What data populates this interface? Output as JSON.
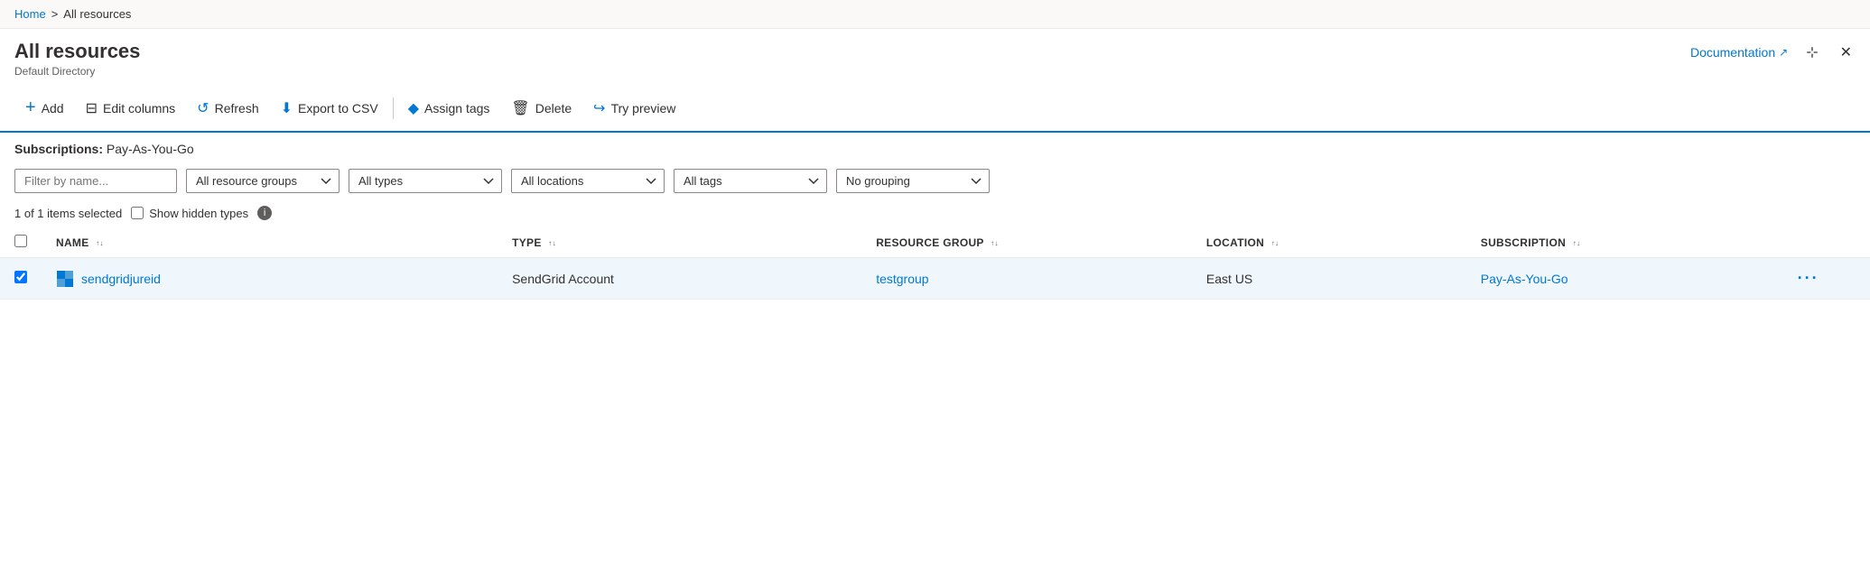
{
  "breadcrumb": {
    "home": "Home",
    "separator": ">",
    "current": "All resources"
  },
  "header": {
    "title": "All resources",
    "subtitle": "Default Directory",
    "documentation_label": "Documentation",
    "pin_title": "Pin",
    "close_title": "Close"
  },
  "toolbar": {
    "add": "Add",
    "edit_columns": "Edit columns",
    "refresh": "Refresh",
    "export_csv": "Export to CSV",
    "assign_tags": "Assign tags",
    "delete": "Delete",
    "try_preview": "Try preview"
  },
  "subscriptions_bar": {
    "label": "Subscriptions:",
    "value": "Pay-As-You-Go"
  },
  "filters": {
    "name_placeholder": "Filter by name...",
    "resource_groups": "All resource groups",
    "types": "All types",
    "locations": "All locations",
    "tags": "All tags",
    "grouping": "No grouping"
  },
  "selection": {
    "count_text": "1 of 1 items selected",
    "show_hidden": "Show hidden types"
  },
  "table": {
    "headers": {
      "name": "NAME",
      "type": "TYPE",
      "resource_group": "RESOURCE GROUP",
      "location": "LOCATION",
      "subscription": "SUBSCRIPTION"
    },
    "rows": [
      {
        "id": 1,
        "name": "sendgridjureid",
        "type": "SendGrid Account",
        "resource_group": "testgroup",
        "location": "East US",
        "subscription": "Pay-As-You-Go",
        "selected": true
      }
    ]
  },
  "icons": {
    "add": "+",
    "edit_columns": "⊞",
    "refresh": "↺",
    "export": "⬇",
    "tags": "◆",
    "delete": "🗑",
    "preview": "↩",
    "external_link": "↗",
    "pin": "⊹",
    "close": "✕",
    "more": "•••",
    "info": "i",
    "sort_up": "▲",
    "sort_down": "▼"
  },
  "colors": {
    "blue": "#0078d4",
    "light_blue_bg": "#eff6fc",
    "border": "#edebe9",
    "toolbar_border": "#0078d4"
  }
}
